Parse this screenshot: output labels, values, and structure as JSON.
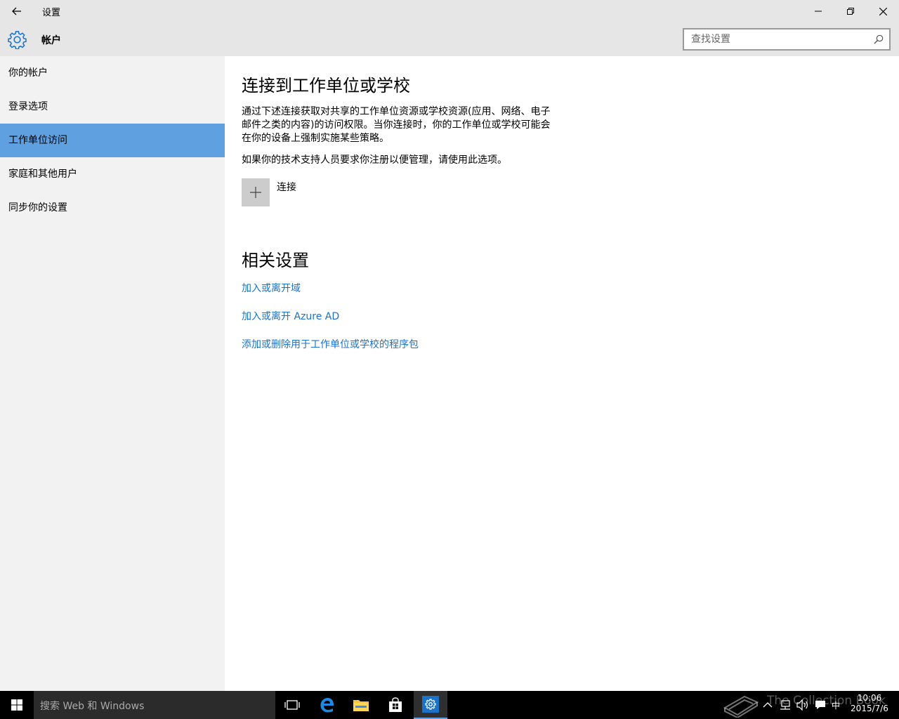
{
  "window": {
    "title": "设置",
    "buttons": [
      "minimize",
      "restore",
      "close"
    ]
  },
  "header": {
    "icon": "gear-icon",
    "title": "帐户",
    "search_placeholder": "查找设置"
  },
  "sidebar": {
    "items": [
      {
        "label": "你的帐户",
        "active": false
      },
      {
        "label": "登录选项",
        "active": false
      },
      {
        "label": "工作单位访问",
        "active": true
      },
      {
        "label": "家庭和其他用户",
        "active": false
      },
      {
        "label": "同步你的设置",
        "active": false
      }
    ]
  },
  "main": {
    "heading": "连接到工作单位或学校",
    "description": "通过下述连接获取对共享的工作单位资源或学校资源(应用、网络、电子邮件之类的内容)的访问权限。当你连接时，你的工作单位或学校可能会在你的设备上强制实施某些策略。",
    "note": "如果你的技术支持人员要求你注册以便管理，请使用此选项。",
    "connect_label": "连接",
    "related_heading": "相关设置",
    "links": [
      "加入或离开域",
      "加入或离开 Azure AD",
      "添加或删除用于工作单位或学校的程序包"
    ]
  },
  "taskbar": {
    "search_placeholder": "搜索 Web 和 Windows",
    "ime": "中",
    "time": "10:06",
    "date": "2015/7/6",
    "watermark": "The Collection Book"
  },
  "colors": {
    "accent": "#5fa0e0",
    "link": "#1a73c8",
    "titlebar": "#e6e6e6",
    "sidebar": "#f2f2f2",
    "taskbar": "#000000"
  }
}
